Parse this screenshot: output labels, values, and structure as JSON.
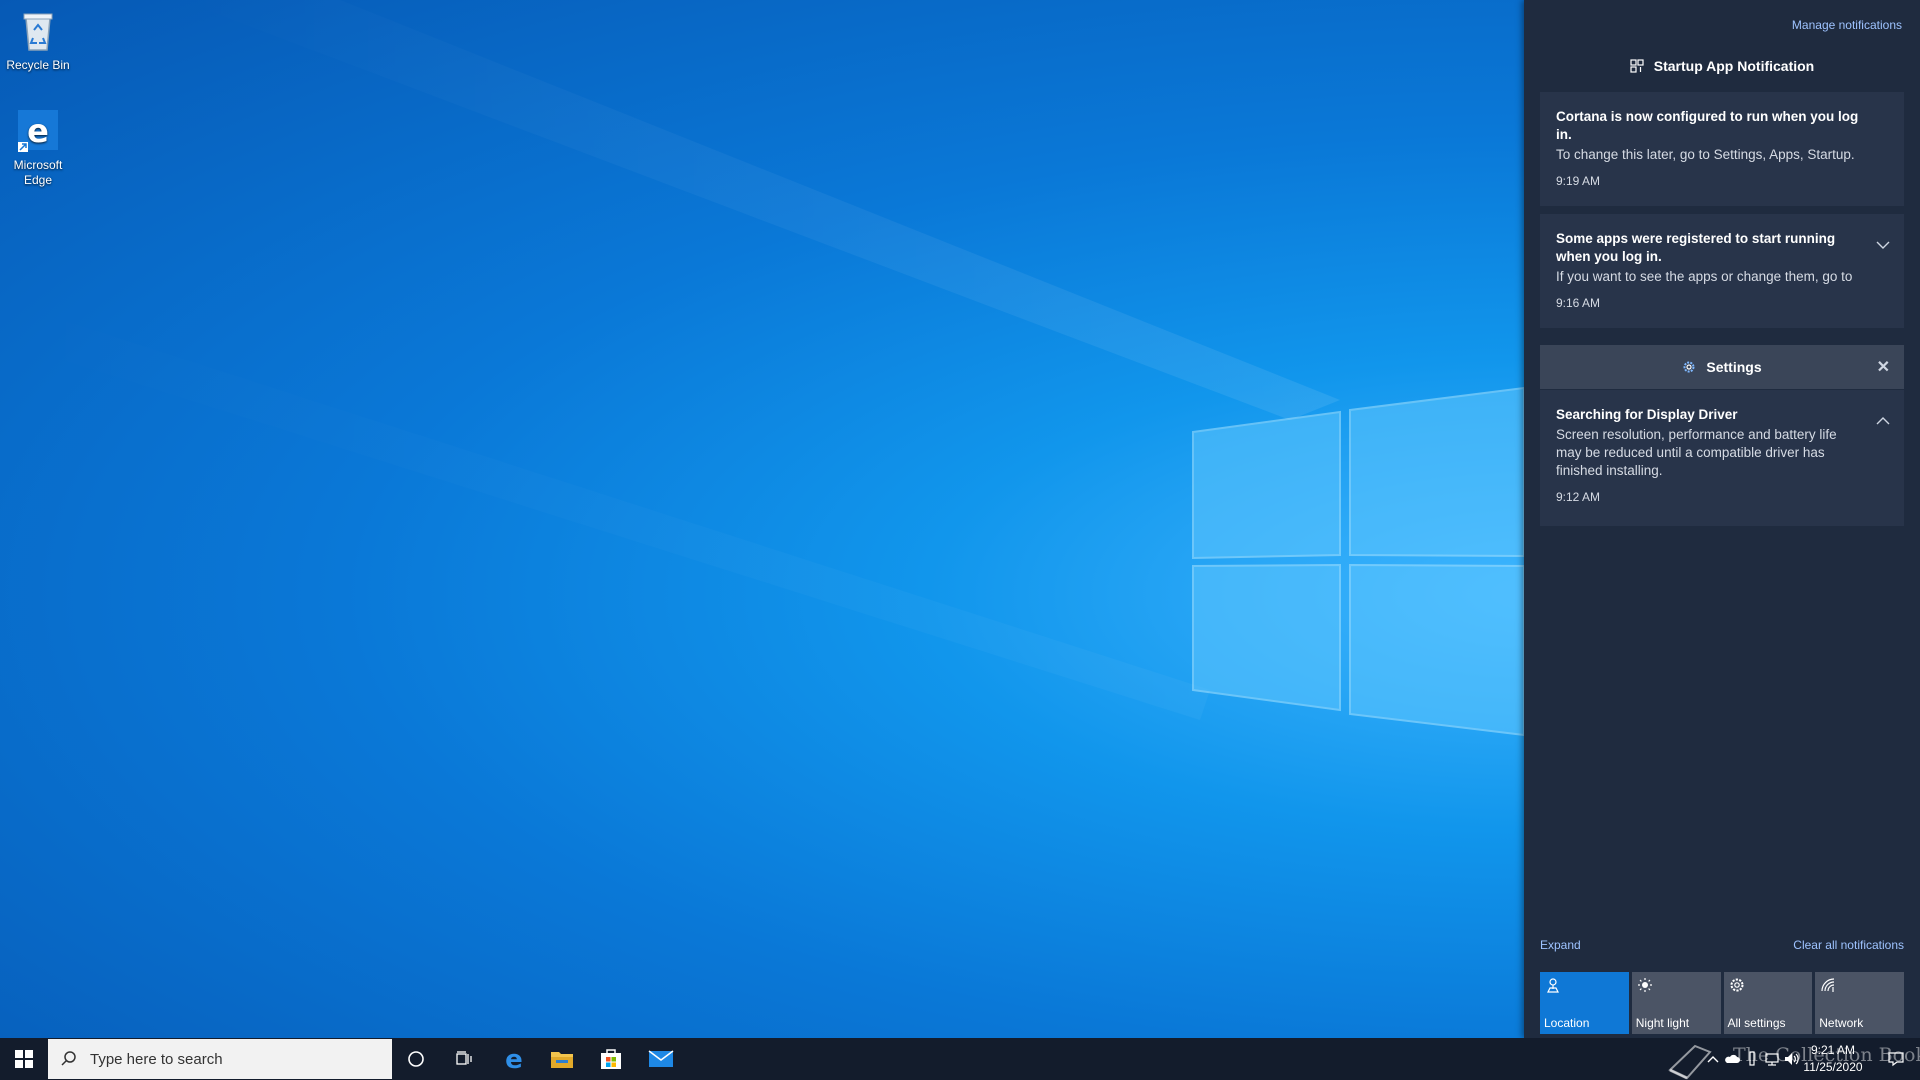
{
  "desktop": {
    "icons": [
      {
        "label": "Recycle Bin",
        "icon": "recycle-bin-icon"
      },
      {
        "label": "Microsoft Edge",
        "icon": "edge-icon"
      }
    ]
  },
  "action_center": {
    "manage_label": "Manage notifications",
    "groups": [
      {
        "header": "Startup App Notification",
        "notifications": [
          {
            "title": "Cortana is now configured to run when you log in.",
            "body": "To change this later, go to Settings, Apps, Startup.",
            "time": "9:19 AM"
          },
          {
            "title": "Some apps were registered to start running when you log in.",
            "body": "If you want to see the apps or change them, go to",
            "time": "9:16 AM"
          }
        ]
      },
      {
        "header": "Settings",
        "notifications": [
          {
            "title": "Searching for Display Driver",
            "body": "Screen resolution, performance and battery life may be reduced until a compatible driver has finished installing.",
            "time": "9:12 AM"
          }
        ]
      }
    ],
    "expand_label": "Expand",
    "clear_label": "Clear all notifications",
    "quick_actions": [
      {
        "label": "Location",
        "icon": "location-icon",
        "active": true
      },
      {
        "label": "Night light",
        "icon": "brightness-icon",
        "active": false
      },
      {
        "label": "All settings",
        "icon": "gear-icon",
        "active": false
      },
      {
        "label": "Network",
        "icon": "network-icon",
        "active": false
      }
    ]
  },
  "taskbar": {
    "search_placeholder": "Type here to search",
    "pinned": [
      "cortana-icon",
      "task-view-icon",
      "edge-icon",
      "file-explorer-icon",
      "store-icon",
      "mail-icon"
    ],
    "clock_time": "9:21 AM",
    "clock_date": "11/25/2020"
  },
  "watermark": "The Collection Book",
  "colors": {
    "accent": "#0f78d6",
    "action_center_bg": "#1f2b3f",
    "taskbar_bg": "#131c2c"
  }
}
